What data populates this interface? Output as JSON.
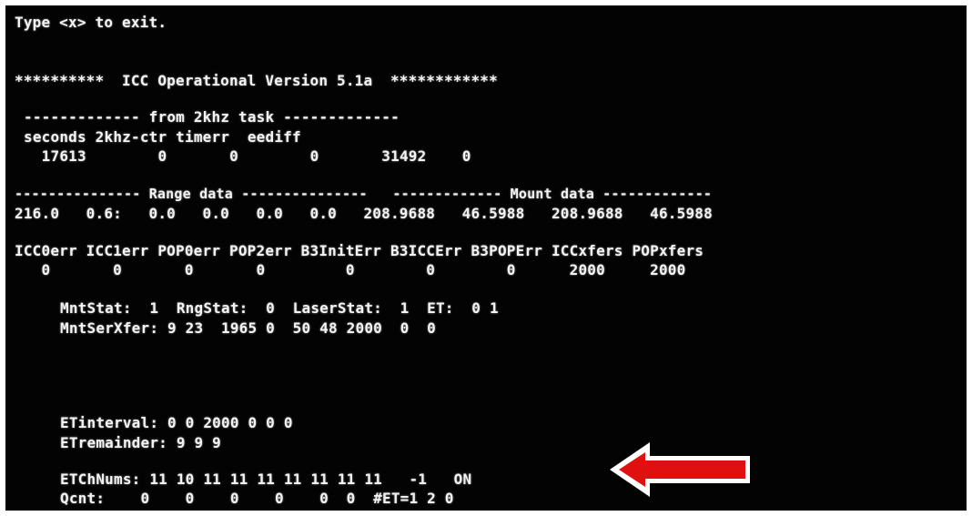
{
  "terminal": {
    "exit_hint": "Type <x> to exit.",
    "title_line": "**********  ICC Operational Version 5.1a  ************",
    "task_section": {
      "header": "------------- from 2khz task -------------",
      "columns": "seconds 2khz-ctr timerr  eediff",
      "values": "  17613        0       0        0       31492    0"
    },
    "range_mount": {
      "header": "--------------- Range data ---------------   ------------- Mount data -------------",
      "values": "216.0   0.6:   0.0   0.0   0.0   0.0   208.9688   46.5988   208.9688   46.5988"
    },
    "errors": {
      "columns": "ICC0err ICC1err POP0err POP2err B3InitErr B3ICCErr B3POPErr ICCxfers POPxfers",
      "values": "   0       0       0       0         0        0        0      2000     2000"
    },
    "status": {
      "line1": "MntStat:  1  RngStat:  0  LaserStat:  1  ET:  0 1",
      "line2": "MntSerXfer: 9 23  1965 0  50 48 2000  0  0"
    },
    "et": {
      "interval": "ETinterval: 0 0 2000 0 0 0",
      "remainder": "ETremainder: 9 9 9",
      "chnums": "ETChNums: 11 10 11 11 11 11 11 11 11   -1   ON",
      "qcnt": "Qcnt:    0    0    0    0    0  0  #ET=1 2 0"
    }
  },
  "annotation": {
    "arrow_fill": "#e01010",
    "arrow_outline": "#ffffff",
    "arrow_icon": "left-arrow-icon"
  }
}
